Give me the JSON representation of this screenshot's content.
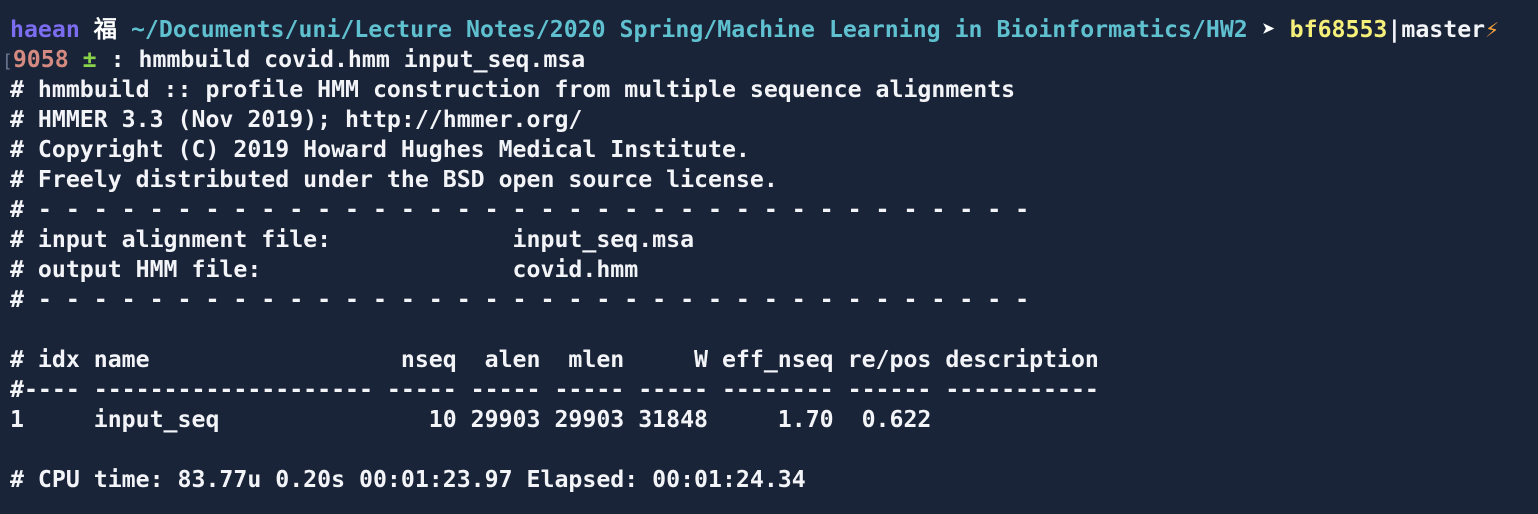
{
  "prompt": {
    "user": "haean",
    "host_glyph": "福",
    "path": "~/Documents/uni/Lecture Notes/2020 Spring/Machine Learning in Bioinformatics/HW2",
    "separator": "➤",
    "commit": "bf68553",
    "branch_sep": "|",
    "branch": "master",
    "dirty_icon": "⚡",
    "bracket": "[",
    "history_num": "9058",
    "vcs_marker": "±",
    "colon": ":",
    "command": "hmmbuild covid.hmm input_seq.msa"
  },
  "output": {
    "lines": [
      "# hmmbuild :: profile HMM construction from multiple sequence alignments",
      "# HMMER 3.3 (Nov 2019); http://hmmer.org/",
      "# Copyright (C) 2019 Howard Hughes Medical Institute.",
      "# Freely distributed under the BSD open source license.",
      "# - - - - - - - - - - - - - - - - - - - - - - - - - - - - - - - - - - - -",
      "# input alignment file:             input_seq.msa",
      "# output HMM file:                  covid.hmm",
      "# - - - - - - - - - - - - - - - - - - - - - - - - - - - - - - - - - - - -",
      "",
      "# idx name                  nseq  alen  mlen     W eff_nseq re/pos description",
      "#---- -------------------- ----- ----- ----- ----- -------- ------ -----------",
      "1     input_seq               10 29903 29903 31848     1.70  0.622",
      "",
      "# CPU time: 83.77u 0.20s 00:01:23.97 Elapsed: 00:01:24.34"
    ]
  },
  "colors": {
    "background": "#1a2438",
    "user": "#7b6cf0",
    "path": "#5fc0cf",
    "commit": "#f5f07a",
    "history_num": "#d48a80",
    "vcs_marker": "#8ad44a"
  }
}
